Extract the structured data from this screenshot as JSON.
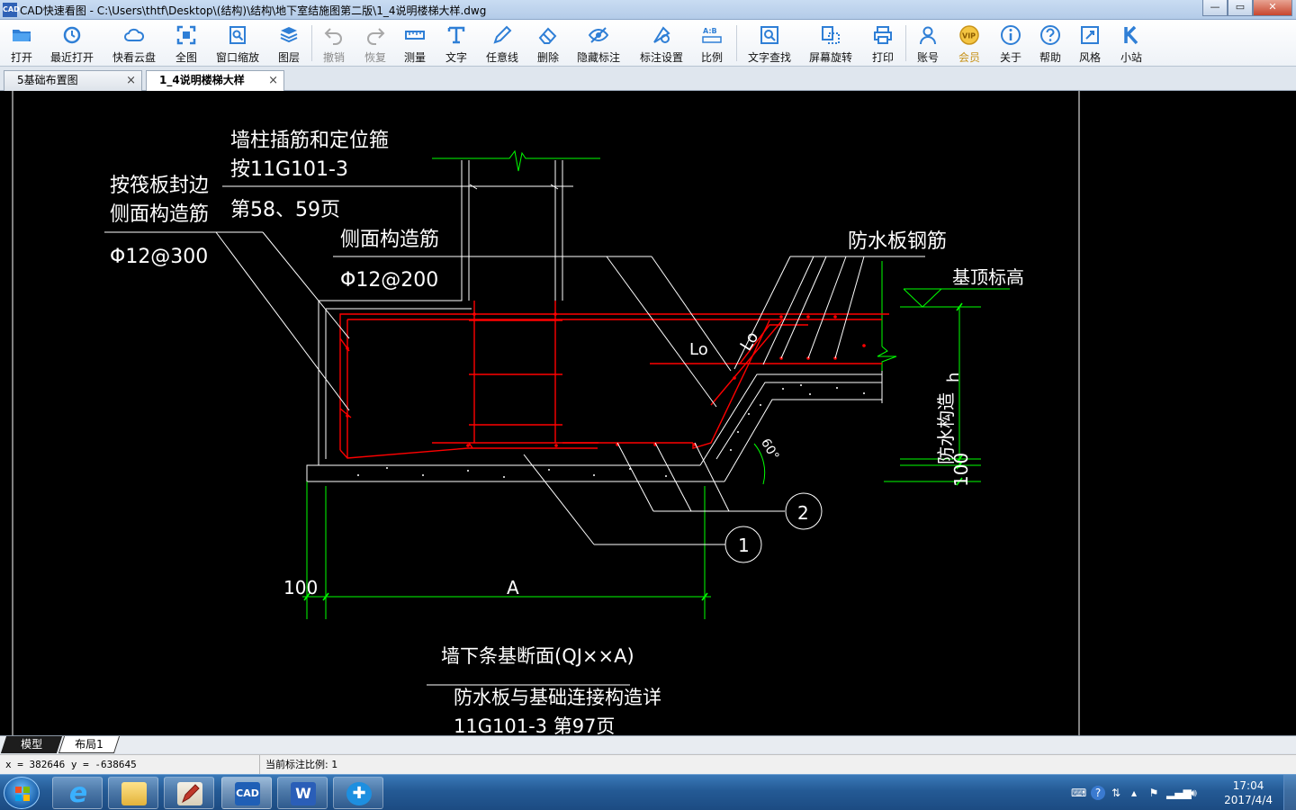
{
  "window": {
    "app_icon": "CAD",
    "title": "CAD快速看图 - C:\\Users\\thtf\\Desktop\\(结构)\\结构\\地下室结施图第二版\\1_4说明楼梯大样.dwg",
    "minimize": "—",
    "maximize": "▭",
    "close": "✕"
  },
  "toolbar": [
    {
      "label": "打开",
      "icon": "folder-icon"
    },
    {
      "label": "最近打开",
      "icon": "history-icon"
    },
    {
      "label": "快看云盘",
      "icon": "cloud-icon"
    },
    {
      "label": "全图",
      "icon": "fullview-icon"
    },
    {
      "label": "窗口缩放",
      "icon": "window-zoom-icon"
    },
    {
      "label": "图层",
      "icon": "layers-icon"
    },
    {
      "label": "撤销",
      "icon": "undo-icon"
    },
    {
      "label": "恢复",
      "icon": "redo-icon"
    },
    {
      "label": "测量",
      "icon": "measure-icon"
    },
    {
      "label": "文字",
      "icon": "text-icon"
    },
    {
      "label": "任意线",
      "icon": "pencil-icon"
    },
    {
      "label": "删除",
      "icon": "eraser-icon"
    },
    {
      "label": "隐藏标注",
      "icon": "eye-hidden-icon"
    },
    {
      "label": "标注设置",
      "icon": "annotation-settings-icon"
    },
    {
      "label": "比例",
      "icon": "scale-icon"
    },
    {
      "label": "文字查找",
      "icon": "text-search-icon"
    },
    {
      "label": "屏幕旋转",
      "icon": "rotate-icon"
    },
    {
      "label": "打印",
      "icon": "printer-icon"
    },
    {
      "label": "账号",
      "icon": "user-icon"
    },
    {
      "label": "会员",
      "icon": "vip-icon"
    },
    {
      "label": "关于",
      "icon": "info-icon"
    },
    {
      "label": "帮助",
      "icon": "help-icon"
    },
    {
      "label": "风格",
      "icon": "style-icon"
    },
    {
      "label": "小站",
      "icon": "k-icon"
    }
  ],
  "tabs": [
    {
      "label": "5基础布置图",
      "close": "×"
    },
    {
      "label": "1_4说明楼梯大样",
      "close": "×"
    }
  ],
  "drawing": {
    "label_wall_col_1": "墙柱插筋和定位箍",
    "label_wall_col_2": "按11G101-3",
    "label_wall_col_3": "第58、59页",
    "label_raft_1": "按筏板封边",
    "label_raft_2": "侧面构造筋",
    "label_raft_3": "Φ12@300",
    "label_side_1": "侧面构造筋",
    "label_side_2": "Φ12@200",
    "label_waterproof": "防水板钢筋",
    "label_top_elev": "基顶标高",
    "label_lo1": "Lo",
    "label_lo2": "Lo",
    "label_h": "h",
    "label_60": "60°",
    "label_wp_detail": "防水构造",
    "label_wp_100": "100",
    "label_100": "100",
    "label_A": "A",
    "label_circle_1": "1",
    "label_circle_2": "2",
    "caption_1": "墙下条基断面(QJ××A)",
    "caption_2": "防水板与基础连接构造详",
    "caption_3": "11G101-3 第97页"
  },
  "layout_tabs": [
    "模型",
    "布局1"
  ],
  "status": {
    "coords": "x = 382646  y = -638645",
    "scale": "当前标注比例: 1"
  },
  "taskbar": {
    "apps": [
      {
        "name": "ie",
        "text": "e"
      },
      {
        "name": "explorer",
        "text": ""
      },
      {
        "name": "editor",
        "text": ""
      },
      {
        "name": "cad",
        "text": "CAD"
      },
      {
        "name": "word",
        "text": "W"
      },
      {
        "name": "feiq",
        "text": "✚"
      }
    ],
    "time": "17:04",
    "date": "2017/4/4"
  },
  "colors": {
    "cad_white": "#ffffff",
    "cad_green": "#00ff00",
    "cad_red": "#ff0000",
    "canvas_bg": "#000000"
  }
}
